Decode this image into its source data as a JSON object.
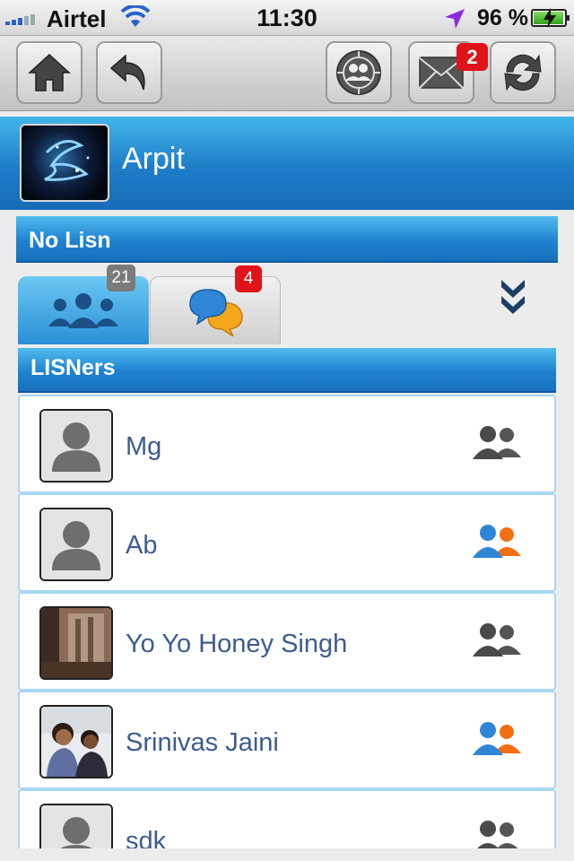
{
  "status_bar": {
    "carrier": "Airtel",
    "time": "11:30",
    "battery": "96 %",
    "battery_level": 0.96
  },
  "toolbar": {
    "mail_badge": "2",
    "icons": [
      "home-icon",
      "back-arrow-icon",
      "group-target-icon",
      "mail-icon",
      "refresh-icon"
    ]
  },
  "profile": {
    "name": "Arpit"
  },
  "sections": {
    "no_lisn": "No Lisn",
    "lisners": "LISNers"
  },
  "tabs": {
    "listeners_count": "21",
    "chats_count": "4"
  },
  "colors": {
    "header_blue": "#1e7dc9",
    "badge_red": "#e0131b",
    "name_text": "#3b5c8f",
    "online_blue": "#2f86d6",
    "online_orange": "#f36f12",
    "offline_gray": "#555555"
  },
  "lisners": [
    {
      "name": "Mg",
      "avatar": "default-avatar",
      "status": "offline"
    },
    {
      "name": "Ab",
      "avatar": "default-avatar",
      "status": "online"
    },
    {
      "name": "Yo Yo Honey Singh",
      "avatar": "photo",
      "status": "offline"
    },
    {
      "name": "Srinivas Jaini",
      "avatar": "photo",
      "status": "online"
    },
    {
      "name": "sdk",
      "avatar": "default-avatar",
      "status": "offline"
    }
  ]
}
